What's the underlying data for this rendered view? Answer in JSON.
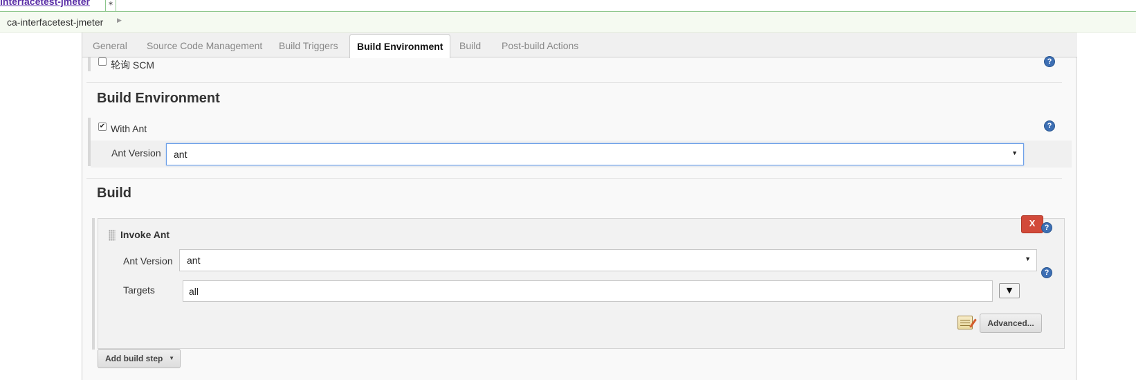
{
  "top": {
    "link_text": "interfacetest-jmeter",
    "separator": "*"
  },
  "breadcrumb": {
    "item": "ca-interfacetest-jmeter"
  },
  "tabs": [
    {
      "label": "General"
    },
    {
      "label": "Source Code Management"
    },
    {
      "label": "Build Triggers"
    },
    {
      "label": "Build Environment"
    },
    {
      "label": "Build"
    },
    {
      "label": "Post-build Actions"
    }
  ],
  "active_tab": "Build Environment",
  "triggers": {
    "poll_scm_label": "轮询 SCM"
  },
  "build_environment": {
    "title": "Build Environment",
    "with_ant_label": "With Ant",
    "ant_version_label": "Ant Version",
    "ant_version_value": "ant"
  },
  "build": {
    "title": "Build",
    "step": {
      "title": "Invoke Ant",
      "delete_label": "X",
      "ant_version_label": "Ant Version",
      "ant_version_value": "ant",
      "targets_label": "Targets",
      "targets_value": "all",
      "advanced_label": "Advanced..."
    },
    "add_step_label": "Add build step"
  },
  "colors": {
    "accent_blue": "#3d6fb4",
    "delete_red": "#d24a3a",
    "top_border_green": "#8cc68c"
  }
}
